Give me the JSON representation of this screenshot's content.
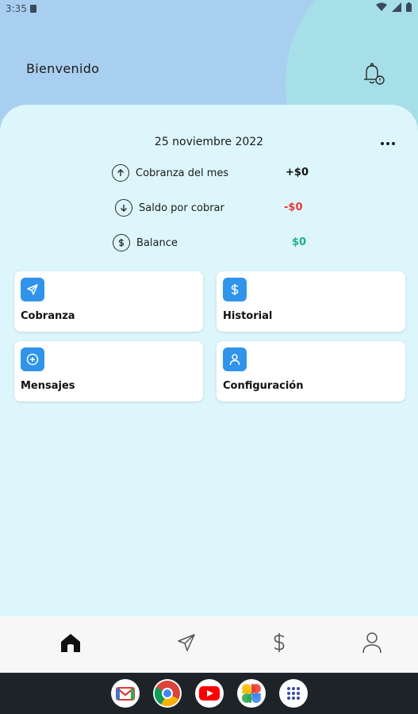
{
  "status_bar": {
    "time": "3:35"
  },
  "header": {
    "greeting": "Bienvenido"
  },
  "summary": {
    "date": "25 noviembre 2022",
    "rows": [
      {
        "label": "Cobranza del mes",
        "value": "+$0",
        "color": "#111111"
      },
      {
        "label": "Saldo por cobrar",
        "value": "-$0",
        "color": "#e53935"
      },
      {
        "label": "Balance",
        "value": "$0",
        "color": "#1fae8f"
      }
    ]
  },
  "cards": [
    {
      "title": "Cobranza",
      "icon": "send-icon"
    },
    {
      "title": "Historial",
      "icon": "dollar-icon"
    },
    {
      "title": "Mensajes",
      "icon": "plus-circle-icon"
    },
    {
      "title": "Configuración",
      "icon": "user-icon"
    }
  ],
  "bottom_nav": [
    "home-icon",
    "send-icon",
    "dollar-icon",
    "user-icon"
  ],
  "dock_apps": [
    "gmail-icon",
    "chrome-icon",
    "youtube-icon",
    "photos-icon",
    "app-drawer-icon"
  ],
  "colors": {
    "accent": "#2f94ea",
    "panel": "#dcf6fb",
    "header": "#a9cff0"
  }
}
